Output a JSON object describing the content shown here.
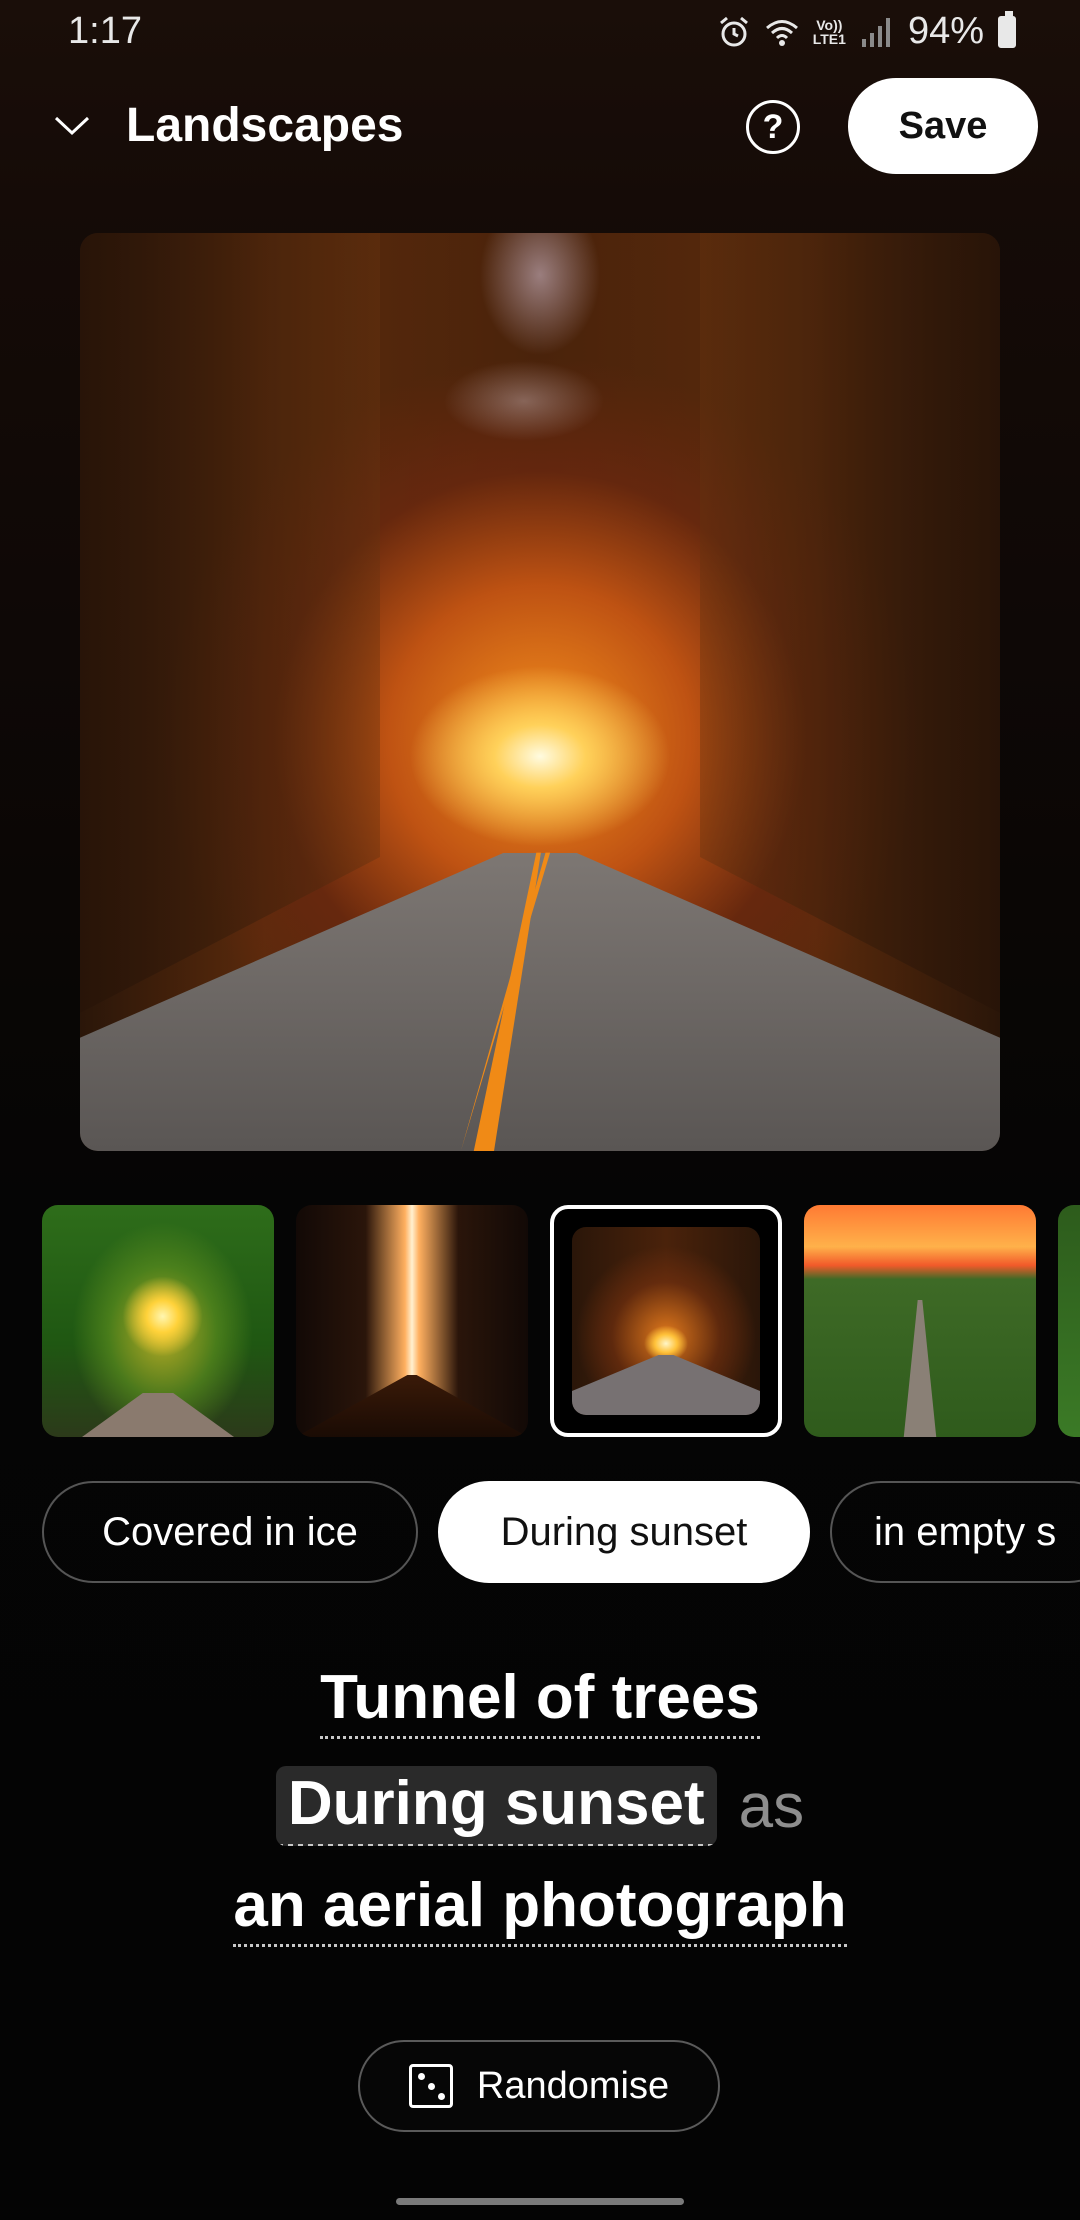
{
  "status_bar": {
    "time": "1:17",
    "lte_label": "LTE1",
    "volte_label": "Vo))",
    "battery": "94%"
  },
  "header": {
    "title": "Landscapes",
    "help_label": "?",
    "save_label": "Save"
  },
  "preview": {
    "icon": "generated-landscape-image"
  },
  "thumbnails": {
    "selected_index": 2,
    "count_visible": 5
  },
  "chips": [
    {
      "label": "Covered in ice",
      "selected": false
    },
    {
      "label": "During sunset",
      "selected": true
    },
    {
      "label": "in empty s",
      "selected": false
    }
  ],
  "prompt": {
    "subject": "Tunnel of trees",
    "modifier": "During sunset",
    "connector": "as",
    "style": "an aerial photograph"
  },
  "randomise": {
    "label": "Randomise"
  },
  "colors": {
    "accent": "#ffffff",
    "background": "#000000",
    "muted_text": "#8e8e8e"
  }
}
